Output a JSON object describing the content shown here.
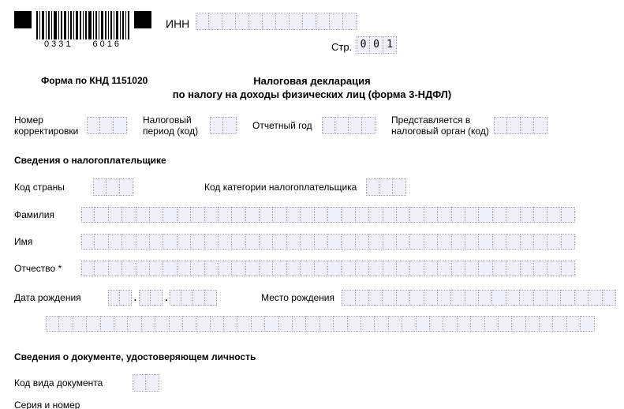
{
  "barcode": {
    "left": "0331",
    "right": "6016"
  },
  "inn": {
    "label": "ИНН",
    "cells": 12
  },
  "page": {
    "label": "Стр.",
    "digits": [
      "0",
      "0",
      "1"
    ]
  },
  "form_code": "Форма по КНД 1151020",
  "title": {
    "line1": "Налоговая декларация",
    "line2": "по налогу на доходы физических лиц (форма 3-НДФЛ)"
  },
  "header_row": {
    "correction": {
      "label": "Номер корректировки",
      "cells": 3
    },
    "tax_period": {
      "label": "Налоговый период (код)",
      "cells": 2
    },
    "report_year": {
      "label": "Отчетный год",
      "cells": 4
    },
    "tax_authority": {
      "label": "Представляется в налоговый орган (код)",
      "cells": 4
    }
  },
  "sections": {
    "payer": "Сведения о налогоплательщике",
    "doc": "Сведения о документе, удостоверяющем личность"
  },
  "payer": {
    "country": {
      "label": "Код страны",
      "cells": 3
    },
    "category": {
      "label": "Код категории налогоплательщика",
      "cells": 3
    },
    "surname": {
      "label": "Фамилия",
      "cells": 36
    },
    "name": {
      "label": "Имя",
      "cells": 36
    },
    "middle": {
      "label": "Отчество *",
      "cells": 36
    },
    "birth_date": {
      "label": "Дата рождения",
      "d": 2,
      "m": 2,
      "y": 4
    },
    "birth_place": {
      "label": "Место рождения",
      "cells": 20
    },
    "extra_cells": 40
  },
  "doc": {
    "type": {
      "label": "Код вида документа",
      "cells": 2
    },
    "series": {
      "label": "Серия и номер"
    }
  }
}
